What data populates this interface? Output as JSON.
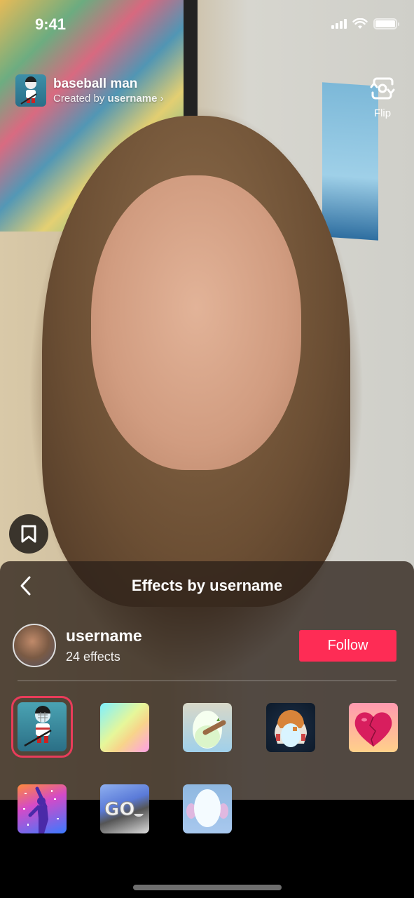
{
  "status_bar": {
    "time": "9:41",
    "icons": [
      "signal-icon",
      "wifi-icon",
      "battery-icon"
    ]
  },
  "effect": {
    "name": "baseball man",
    "created_by_prefix": "Created by ",
    "creator": "username",
    "chevron": "›"
  },
  "flip": {
    "label": "Flip",
    "icon": "flip-camera-icon"
  },
  "panel": {
    "title": "Effects by username",
    "back_icon": "chevron-left-icon",
    "creator": {
      "name": "username",
      "effects_count": "24 effects"
    },
    "follow_label": "Follow",
    "accent_color": "#fe2c55",
    "effects": [
      {
        "name": "hockey player",
        "icon": "hockey-player-icon",
        "selected": true
      },
      {
        "name": "pastel gradient",
        "icon": "gradient-icon",
        "selected": false
      },
      {
        "name": "egg face with bat",
        "icon": "egg-bat-icon",
        "selected": false
      },
      {
        "name": "astronaut helmet",
        "icon": "astronaut-icon",
        "selected": false
      },
      {
        "name": "broken heart",
        "icon": "broken-heart-icon",
        "selected": false
      },
      {
        "name": "dancer confetti",
        "icon": "dancer-icon",
        "selected": false
      },
      {
        "name": "GO bell",
        "icon": "go-bell-icon",
        "selected": false
      },
      {
        "name": "face with ears",
        "icon": "ears-face-icon",
        "selected": false
      }
    ]
  }
}
